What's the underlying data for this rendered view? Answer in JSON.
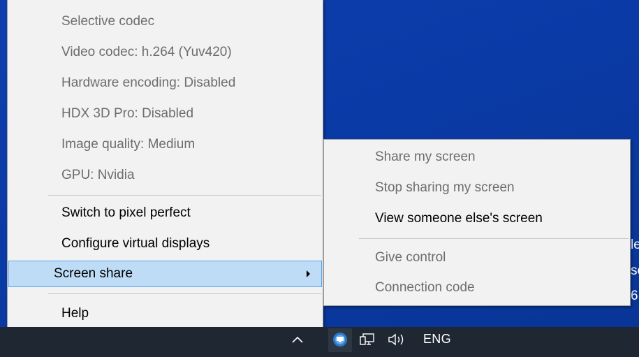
{
  "main_menu": {
    "info_items": [
      "Selective codec",
      "Video codec: h.264 (Yuv420)",
      "Hardware encoding: Disabled",
      "HDX 3D Pro: Disabled",
      "Image quality: Medium",
      "GPU: Nvidia"
    ],
    "switch_pixel_perfect": "Switch to pixel perfect",
    "configure_virtual_displays": "Configure virtual displays",
    "screen_share": "Screen share",
    "help": "Help"
  },
  "submenu": {
    "share_my_screen": "Share my screen",
    "stop_sharing": "Stop sharing my screen",
    "view_someone_else": "View someone else's screen",
    "give_control": "Give control",
    "connection_code": "Connection code"
  },
  "taskbar": {
    "language": "ENG",
    "icons": [
      "chevron-up-icon",
      "citrix-receiver-icon",
      "network-icon",
      "speaker-icon"
    ]
  },
  "colors": {
    "desktop_blue": "#0a3aa6",
    "taskbar": "#1f2733",
    "menu_bg": "#f2f2f2",
    "hover_bg": "#bfdcf6",
    "hover_border": "#5da4e8",
    "disabled_text": "#6d6d6d"
  }
}
